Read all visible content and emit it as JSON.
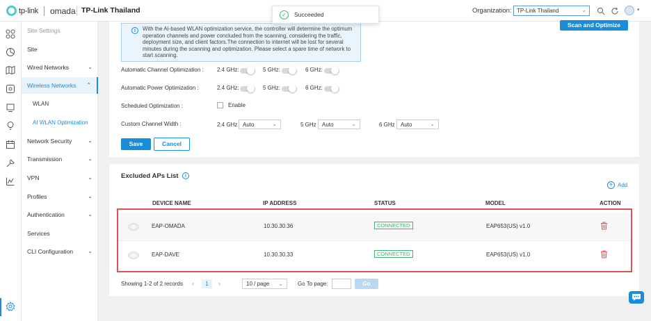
{
  "header": {
    "brand": "tp-link",
    "product": "omada",
    "site_name": "TP-Link Thailand",
    "org_label": "Organization:",
    "org_value": "TP-Link Thailand",
    "toast": "Succeeded"
  },
  "sidebar": {
    "header": "Site Settings",
    "items": [
      {
        "label": "Site"
      },
      {
        "label": "Wired Networks"
      },
      {
        "label": "Wireless Networks"
      },
      {
        "label": "WLAN"
      },
      {
        "label": "AI WLAN Optimization"
      },
      {
        "label": "Network Security"
      },
      {
        "label": "Transmission"
      },
      {
        "label": "VPN"
      },
      {
        "label": "Profiles"
      },
      {
        "label": "Authentication"
      },
      {
        "label": "Services"
      },
      {
        "label": "CLI Configuration"
      }
    ]
  },
  "optimization": {
    "info_text": "With the AI-based WLAN optimization service, the controller will determine the optimum operation channels and power concluded from the scanning, considering the traffic, deployment size, and client factors.The connection to internet will be lost for several minutes during the scanning and optimization. Please select a spare time of network to start scanning.",
    "scan_button": "Scan and Optimize",
    "auto_channel_label": "Automatic Channel Optimization :",
    "auto_power_label": "Automatic Power Optimization :",
    "scheduled_label": "Scheduled Optimization :",
    "enable_label": "Enable",
    "channel_width_label": "Custom Channel Width :",
    "band_24": "2.4 GHz:",
    "band_5": "5 GHz:",
    "band_6": "6 GHz:",
    "width_24_label": "2.4 GHz",
    "width_5_label": "5 GHz",
    "width_6_label": "6 GHz",
    "width_24_value": "Auto",
    "width_5_value": "Auto",
    "width_6_value": "Auto",
    "save_button": "Save",
    "cancel_button": "Cancel"
  },
  "excluded": {
    "title": "Excluded APs List",
    "add_label": "Add",
    "columns": [
      "DEVICE NAME",
      "IP ADDRESS",
      "STATUS",
      "MODEL",
      "ACTION"
    ],
    "rows": [
      {
        "name": "EAP-OMADA",
        "ip": "10.30.30.36",
        "status": "CONNECTED",
        "model": "EAP653(US) v1.0"
      },
      {
        "name": "EAP-DAVE",
        "ip": "10.30.30.33",
        "status": "CONNECTED",
        "model": "EAP653(US) v1.0"
      }
    ],
    "pager_text": "Showing 1-2 of 2 records",
    "current_page": "1",
    "per_page": "10 / page",
    "goto_label": "Go To page:",
    "go_button": "Go"
  }
}
